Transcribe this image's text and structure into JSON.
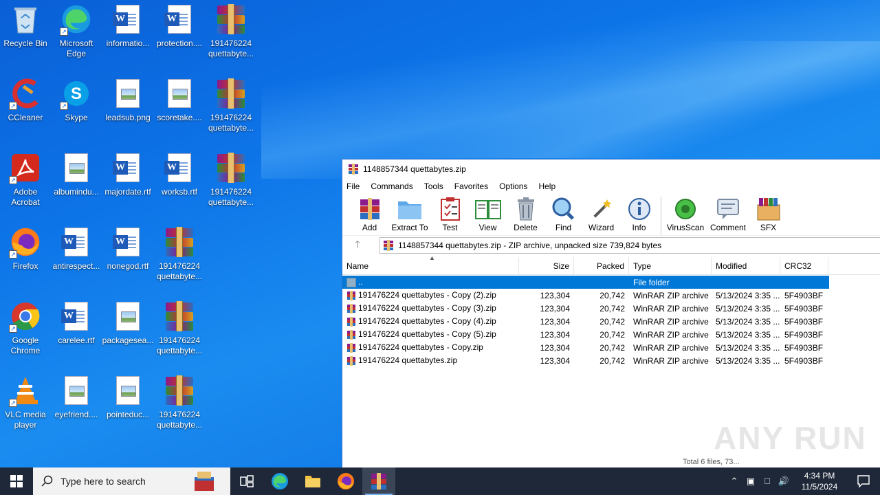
{
  "desktop": {
    "icons": [
      {
        "label": "Recycle Bin",
        "icon": "recycle-bin-icon"
      },
      {
        "label": "Microsoft Edge",
        "icon": "edge-icon"
      },
      {
        "label": "informatio...",
        "icon": "word-doc-icon"
      },
      {
        "label": "protection....",
        "icon": "word-doc-icon"
      },
      {
        "label": "191476224 quettabyte...",
        "icon": "winrar-archive-icon"
      },
      {
        "label": "CCleaner",
        "icon": "ccleaner-icon"
      },
      {
        "label": "Skype",
        "icon": "skype-icon"
      },
      {
        "label": "leadsub.png",
        "icon": "image-file-icon"
      },
      {
        "label": "scoretake....",
        "icon": "image-file-icon"
      },
      {
        "label": "191476224 quettabyte...",
        "icon": "winrar-archive-icon"
      },
      {
        "label": "Adobe Acrobat",
        "icon": "acrobat-icon"
      },
      {
        "label": "albumindu...",
        "icon": "image-file-icon"
      },
      {
        "label": "majordate.rtf",
        "icon": "word-doc-icon"
      },
      {
        "label": "worksb.rtf",
        "icon": "word-doc-icon"
      },
      {
        "label": "191476224 quettabyte...",
        "icon": "winrar-archive-icon"
      },
      {
        "label": "Firefox",
        "icon": "firefox-icon"
      },
      {
        "label": "antirespect...",
        "icon": "word-doc-icon"
      },
      {
        "label": "nonegod.rtf",
        "icon": "word-doc-icon"
      },
      {
        "label": "191476224 quettabyte...",
        "icon": "winrar-archive-icon"
      },
      {
        "label": "Google Chrome",
        "icon": "chrome-icon"
      },
      {
        "label": "carelee.rtf",
        "icon": "word-doc-icon"
      },
      {
        "label": "packagesea...",
        "icon": "image-file-icon"
      },
      {
        "label": "191476224 quettabyte...",
        "icon": "winrar-archive-icon"
      },
      {
        "label": "VLC media player",
        "icon": "vlc-icon"
      },
      {
        "label": "eyefriend....",
        "icon": "image-file-icon"
      },
      {
        "label": "pointeduc...",
        "icon": "image-file-icon"
      },
      {
        "label": "191476224 quettabyte...",
        "icon": "winrar-archive-icon"
      }
    ]
  },
  "window": {
    "title": "1148857344 quettabytes.zip",
    "menu": [
      "File",
      "Commands",
      "Tools",
      "Favorites",
      "Options",
      "Help"
    ],
    "toolbar": [
      {
        "label": "Add",
        "icon": "add-archive-icon"
      },
      {
        "label": "Extract To",
        "icon": "extract-folder-icon"
      },
      {
        "label": "Test",
        "icon": "test-clipboard-icon"
      },
      {
        "label": "View",
        "icon": "view-book-icon"
      },
      {
        "label": "Delete",
        "icon": "trash-icon"
      },
      {
        "label": "Find",
        "icon": "magnifier-icon"
      },
      {
        "label": "Wizard",
        "icon": "wand-icon"
      },
      {
        "label": "Info",
        "icon": "info-icon"
      },
      {
        "label": "VirusScan",
        "icon": "virus-scan-icon"
      },
      {
        "label": "Comment",
        "icon": "comment-icon"
      },
      {
        "label": "SFX",
        "icon": "sfx-box-icon"
      }
    ],
    "address": "1148857344 quettabytes.zip - ZIP archive, unpacked size 739,824 bytes",
    "columns": {
      "name": "Name",
      "size": "Size",
      "packed": "Packed",
      "type": "Type",
      "modified": "Modified",
      "crc": "CRC32"
    },
    "parent_row": {
      "name": "..",
      "type": "File folder"
    },
    "rows": [
      {
        "name": "191476224 quettabytes - Copy (2).zip",
        "size": "123,304",
        "packed": "20,742",
        "type": "WinRAR ZIP archive",
        "modified": "5/13/2024 3:35 ...",
        "crc": "5F4903BF"
      },
      {
        "name": "191476224 quettabytes - Copy (3).zip",
        "size": "123,304",
        "packed": "20,742",
        "type": "WinRAR ZIP archive",
        "modified": "5/13/2024 3:35 ...",
        "crc": "5F4903BF"
      },
      {
        "name": "191476224 quettabytes - Copy (4).zip",
        "size": "123,304",
        "packed": "20,742",
        "type": "WinRAR ZIP archive",
        "modified": "5/13/2024 3:35 ...",
        "crc": "5F4903BF"
      },
      {
        "name": "191476224 quettabytes - Copy (5).zip",
        "size": "123,304",
        "packed": "20,742",
        "type": "WinRAR ZIP archive",
        "modified": "5/13/2024 3:35 ...",
        "crc": "5F4903BF"
      },
      {
        "name": "191476224 quettabytes - Copy.zip",
        "size": "123,304",
        "packed": "20,742",
        "type": "WinRAR ZIP archive",
        "modified": "5/13/2024 3:35 ...",
        "crc": "5F4903BF"
      },
      {
        "name": "191476224 quettabytes.zip",
        "size": "123,304",
        "packed": "20,742",
        "type": "WinRAR ZIP archive",
        "modified": "5/13/2024 3:35 ...",
        "crc": "5F4903BF"
      }
    ],
    "status": "Total 6 files, 73..."
  },
  "watermark": "ANY RUN",
  "taskbar": {
    "search_placeholder": "Type here to search",
    "time": "4:34 PM",
    "date": "11/5/2024"
  },
  "colors": {
    "selection": "#0078d7",
    "taskbar": "#1f2838",
    "wallpaper": "#0d74e8"
  }
}
